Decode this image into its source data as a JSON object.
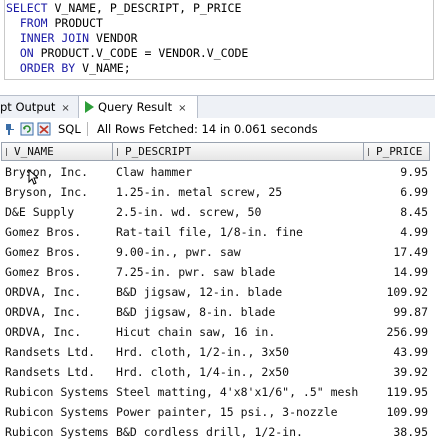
{
  "editor": {
    "lines": [
      [
        {
          "t": "SELECT",
          "kw": true
        },
        {
          "t": " V_NAME, P_DESCRIPT, P_PRICE",
          "kw": false
        }
      ],
      [
        {
          "t": "  FROM",
          "kw": true
        },
        {
          "t": " PRODUCT",
          "kw": false
        }
      ],
      [
        {
          "t": "  INNER JOIN",
          "kw": true
        },
        {
          "t": " VENDOR",
          "kw": false
        }
      ],
      [
        {
          "t": "  ON",
          "kw": true
        },
        {
          "t": " PRODUCT.V_CODE = VENDOR.V_CODE",
          "kw": false
        }
      ],
      [
        {
          "t": "  ORDER BY",
          "kw": true
        },
        {
          "t": " V_NAME;",
          "kw": false
        }
      ]
    ]
  },
  "tabs": {
    "script_output": "pt Output",
    "query_result": "Query Result",
    "close": "×"
  },
  "toolbar": {
    "sql_label": "SQL",
    "status": "All Rows Fetched: 14 in 0.061 seconds"
  },
  "grid": {
    "columns": [
      "V_NAME",
      "P_DESCRIPT",
      "P_PRICE"
    ],
    "rows": [
      [
        "Bryson, Inc.",
        "Claw hammer",
        "9.95"
      ],
      [
        "Bryson, Inc.",
        "1.25-in. metal screw, 25",
        "6.99"
      ],
      [
        "D&E Supply",
        "2.5-in. wd. screw, 50",
        "8.45"
      ],
      [
        "Gomez Bros.",
        "Rat-tail file, 1/8-in. fine",
        "4.99"
      ],
      [
        "Gomez Bros.",
        "9.00-in., pwr. saw",
        "17.49"
      ],
      [
        "Gomez Bros.",
        "7.25-in. pwr. saw blade",
        "14.99"
      ],
      [
        "ORDVA, Inc.",
        "B&D jigsaw, 12-in. blade",
        "109.92"
      ],
      [
        "ORDVA, Inc.",
        "B&D jigsaw, 8-in. blade",
        "99.87"
      ],
      [
        "ORDVA, Inc.",
        "Hicut chain saw, 16 in.",
        "256.99"
      ],
      [
        "Randsets Ltd.",
        "Hrd. cloth, 1/2-in., 3x50",
        "43.99"
      ],
      [
        "Randsets Ltd.",
        "Hrd. cloth, 1/4-in., 2x50",
        "39.92"
      ],
      [
        "Rubicon Systems",
        "Steel matting, 4'x8'x1/6\", .5\" mesh",
        "119.95"
      ],
      [
        "Rubicon Systems",
        "Power painter, 15 psi., 3-nozzle",
        "109.99"
      ],
      [
        "Rubicon Systems",
        "B&D cordless drill, 1/2-in.",
        "38.95"
      ]
    ]
  },
  "colors": {
    "keyword": "#1a1aa6",
    "play": "#2e9e3a"
  }
}
